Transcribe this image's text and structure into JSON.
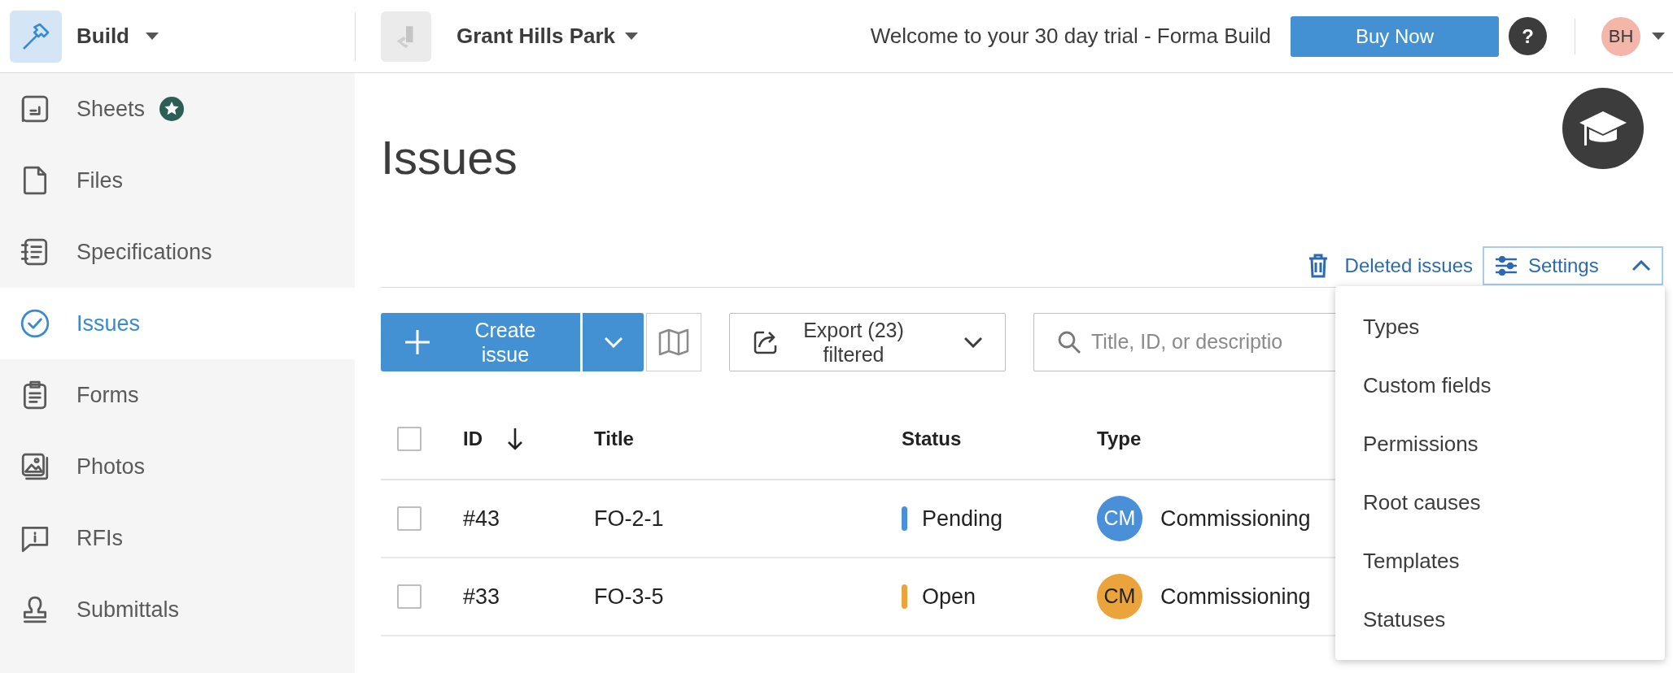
{
  "app": {
    "name": "Build"
  },
  "project": {
    "name": "Grant Hills Park"
  },
  "banner": "Welcome to your 30 day trial - Forma Build",
  "buy_button": "Buy Now",
  "help_button": "?",
  "user": {
    "initials": "BH"
  },
  "sidebar": {
    "items": [
      {
        "kind": "sheets",
        "label": "Sheets",
        "badge": true,
        "selected": false
      },
      {
        "kind": "files",
        "label": "Files",
        "badge": false,
        "selected": false
      },
      {
        "kind": "specifications",
        "label": "Specifications",
        "badge": false,
        "selected": false
      },
      {
        "kind": "issues",
        "label": "Issues",
        "badge": false,
        "selected": true
      },
      {
        "kind": "forms",
        "label": "Forms",
        "badge": false,
        "selected": false
      },
      {
        "kind": "photos",
        "label": "Photos",
        "badge": false,
        "selected": false
      },
      {
        "kind": "rfis",
        "label": "RFIs",
        "badge": false,
        "selected": false
      },
      {
        "kind": "submittals",
        "label": "Submittals",
        "badge": false,
        "selected": false
      }
    ]
  },
  "page": {
    "title": "Issues"
  },
  "deleted_link": "Deleted issues",
  "settings": {
    "label": "Settings",
    "expanded": true,
    "menu": [
      "Types",
      "Custom fields",
      "Permissions",
      "Root causes",
      "Templates",
      "Statuses"
    ]
  },
  "toolbar": {
    "create": "Create issue",
    "export": "Export (23) filtered",
    "search": {
      "placeholder": "Title, ID, or descriptio"
    }
  },
  "table": {
    "all_checked": false,
    "columns": [
      "ID",
      "Title",
      "Status",
      "Type"
    ],
    "rows": [
      {
        "checked": false,
        "id": "#43",
        "title": "FO-2-1",
        "status": {
          "label": "Pending",
          "color": "#4a90d9"
        },
        "type": {
          "initials": "CM",
          "label": "Commissioning",
          "color": "#4a90d9"
        }
      },
      {
        "checked": false,
        "id": "#33",
        "title": "FO-3-5",
        "status": {
          "label": "Open",
          "color": "#eba33c"
        },
        "type": {
          "initials": "CM",
          "label": "Commissioning",
          "color": "#eba33c"
        }
      }
    ]
  }
}
